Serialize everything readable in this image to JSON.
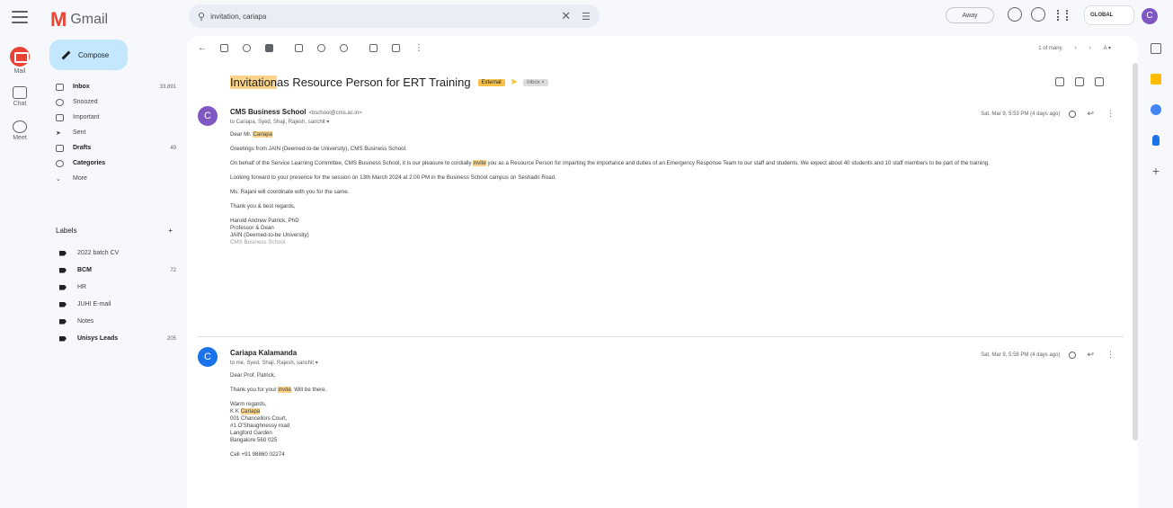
{
  "rail": {
    "items": [
      {
        "label": "Mail"
      },
      {
        "label": "Chat"
      },
      {
        "label": "Meet"
      }
    ]
  },
  "header": {
    "app_name": "Gmail",
    "search_value": "invitation, cariapa",
    "status": "Away",
    "org_name": "GLOBAL"
  },
  "compose_label": "Compose",
  "nav": [
    {
      "label": "Inbox",
      "count": "33,891",
      "bold": true
    },
    {
      "label": "Snoozed",
      "count": ""
    },
    {
      "label": "Important",
      "count": ""
    },
    {
      "label": "Sent",
      "count": ""
    },
    {
      "label": "Drafts",
      "count": "49",
      "bold": true
    },
    {
      "label": "Categories",
      "count": "",
      "bold": true
    },
    {
      "label": "More",
      "count": ""
    }
  ],
  "labels_title": "Labels",
  "labels_add": "+",
  "labels": [
    {
      "label": "2022 batch CV",
      "count": ""
    },
    {
      "label": "BCM",
      "count": "72",
      "bold": true
    },
    {
      "label": "HR",
      "count": ""
    },
    {
      "label": "JUHI E-mail",
      "count": ""
    },
    {
      "label": "Notes",
      "count": ""
    },
    {
      "label": "Unisys Leads",
      "count": "205",
      "bold": true
    }
  ],
  "toolbar": {
    "pager_text": "1 of many",
    "prev": "‹",
    "next": "›",
    "input_label": "A ▾"
  },
  "thread": {
    "subject_hl": "Invitation",
    "subject_rest": " as Resource Person for ERT Training",
    "badge": "External",
    "badge2": "Inbox ×"
  },
  "messages": [
    {
      "avatar": "C",
      "avatar_color": "#7e57c2",
      "sender": "CMS Business School",
      "email": "<bschool@cms.ac.in>",
      "to": "to Cariapa, Syed, Shaji, Rajesh, sanchit ▾",
      "date": "Sat, Mar 9, 5:53 PM (4 days ago)",
      "salutation_pre": "Dear Mr. ",
      "salutation_hl": "Cariapa",
      "greeting": "Greetings from JAIN (Deemed-to-be University), CMS Business School.",
      "para_pre": "On behalf of the Service Learning Committee, CMS Business School, it is our pleasure to cordially ",
      "para_hl": "invite",
      "para_post": " you as a Resource Person for imparting the importance and duties of an Emergency Response Team to our staff and students. We expect about 40 students and 10 staff members to be part of the training.",
      "looking": "Looking forward to your presence for the session on 13th March 2024 at 2:00 PM in the Business School campus on Seshadri Road.",
      "coord": "Ms. Rajani will coordinate with you for the same.",
      "thanks": "Thank you & best regards,",
      "sig1": "Harold Andrew Patrick, PhD",
      "sig2": "Professor & Dean",
      "sig3": "JAIN (Deemed-to-be University)",
      "sig4": "CMS Business School"
    },
    {
      "avatar": "C",
      "avatar_color": "#1a73e8",
      "sender": "Cariapa Kalamanda",
      "email": "",
      "to": "to me, Syed, Shaji, Rajesh, sanchit ▾",
      "date": "Sat, Mar 9, 5:58 PM (4 days ago)",
      "salutation": "Dear Prof. Patrick,",
      "thanks_pre": "Thank you for your ",
      "thanks_hl": "invite",
      "thanks_post": ". Will be there.",
      "warm": "Warm regards,",
      "name_pre": "K K ",
      "name_hl": "Cariapa",
      "addr1": "001 Chancellors Court,",
      "addr2": "#1 O'Shaughnessy road",
      "addr3": "Langford Garden",
      "addr4": "Bangalore 560 025",
      "cell": "Cell +91 98860 02274"
    }
  ],
  "colors": {
    "accent": "#c2e7ff",
    "highlight": "#fbd48a",
    "gmail_red": "#ea4335"
  }
}
